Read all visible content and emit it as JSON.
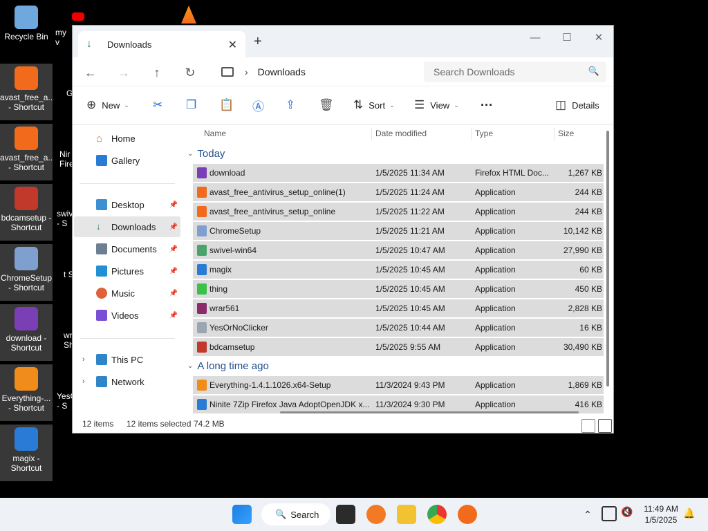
{
  "desktop": {
    "icons": [
      {
        "label": "Recycle Bin",
        "color": "#6fa8dc"
      },
      {
        "label": "avast_free_a... - Shortcut",
        "color": "#f26a1b"
      },
      {
        "label": "avast_free_a... - Shortcut",
        "color": "#f26a1b"
      },
      {
        "label": "bdcamsetup - Shortcut",
        "color": "#c0392b"
      },
      {
        "label": "ChromeSetup - Shortcut",
        "color": "#7f9fcf"
      },
      {
        "label": "download - Shortcut",
        "color": "#7b3fb5"
      },
      {
        "label": "Everything-... - Shortcut",
        "color": "#f08c1a"
      },
      {
        "label": "magix - Shortcut",
        "color": "#2a7bd6"
      }
    ],
    "partial_labels": [
      "my v",
      "G C",
      "Nir Firef",
      "swiv - S",
      "t Sh",
      "wr Sh",
      "YesC - S"
    ]
  },
  "window": {
    "tab_title": "Downloads",
    "breadcrumb": "Downloads",
    "search_placeholder": "Search Downloads",
    "toolbar": {
      "new_label": "New",
      "sort_label": "Sort",
      "view_label": "View",
      "details_label": "Details"
    },
    "nav": {
      "home": "Home",
      "gallery": "Gallery",
      "desktop": "Desktop",
      "downloads": "Downloads",
      "documents": "Documents",
      "pictures": "Pictures",
      "music": "Music",
      "videos": "Videos",
      "this_pc": "This PC",
      "network": "Network"
    },
    "columns": {
      "name": "Name",
      "date": "Date modified",
      "type": "Type",
      "size": "Size"
    },
    "groups": {
      "today": "Today",
      "long_ago": "A long time ago"
    },
    "files": [
      {
        "name": "download",
        "date": "1/5/2025 11:34 AM",
        "type": "Firefox HTML Doc...",
        "size": "1,267 KB",
        "icon_color": "#7b3fb5"
      },
      {
        "name": "avast_free_antivirus_setup_online(1)",
        "date": "1/5/2025 11:24 AM",
        "type": "Application",
        "size": "244 KB",
        "icon_color": "#f26a1b"
      },
      {
        "name": "avast_free_antivirus_setup_online",
        "date": "1/5/2025 11:22 AM",
        "type": "Application",
        "size": "244 KB",
        "icon_color": "#f26a1b"
      },
      {
        "name": "ChromeSetup",
        "date": "1/5/2025 11:21 AM",
        "type": "Application",
        "size": "10,142 KB",
        "icon_color": "#7f9fcf"
      },
      {
        "name": "swivel-win64",
        "date": "1/5/2025 10:47 AM",
        "type": "Application",
        "size": "27,990 KB",
        "icon_color": "#4aa36b"
      },
      {
        "name": "magix",
        "date": "1/5/2025 10:45 AM",
        "type": "Application",
        "size": "60 KB",
        "icon_color": "#2a7bd6"
      },
      {
        "name": "thing",
        "date": "1/5/2025 10:45 AM",
        "type": "Application",
        "size": "450 KB",
        "icon_color": "#3ac14a"
      },
      {
        "name": "wrar561",
        "date": "1/5/2025 10:45 AM",
        "type": "Application",
        "size": "2,828 KB",
        "icon_color": "#8b2b6a"
      },
      {
        "name": "YesOrNoClicker",
        "date": "1/5/2025 10:44 AM",
        "type": "Application",
        "size": "16 KB",
        "icon_color": "#9aa6b2"
      },
      {
        "name": "bdcamsetup",
        "date": "1/5/2025 9:55 AM",
        "type": "Application",
        "size": "30,490 KB",
        "icon_color": "#c0392b"
      }
    ],
    "old_files": [
      {
        "name": "Everything-1.4.1.1026.x64-Setup",
        "date": "11/3/2024 9:43 PM",
        "type": "Application",
        "size": "1,869 KB",
        "icon_color": "#f08c1a"
      },
      {
        "name": "Ninite 7Zip Firefox Java AdoptOpenJDK x...",
        "date": "11/3/2024 9:30 PM",
        "type": "Application",
        "size": "416 KB",
        "icon_color": "#2a7bd6"
      }
    ],
    "status": {
      "items": "12 items",
      "selected": "12 items selected",
      "size": "74.2 MB"
    }
  },
  "taskbar": {
    "search_label": "Search",
    "time": "11:49 AM",
    "date": "1/5/2025"
  }
}
